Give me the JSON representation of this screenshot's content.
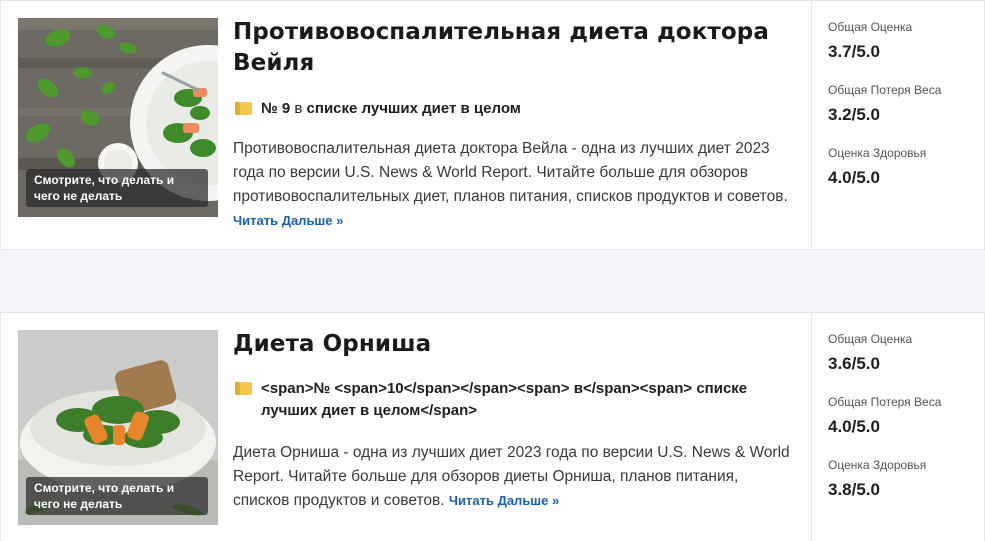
{
  "cards": [
    {
      "title": "Противовоспалительная диета доктора Вейля",
      "rank_bold": "№ 9",
      "rank_in": "в",
      "rank_list": "списке лучших диет в целом",
      "description": "Противовоспалительная диета доктора Вейла - одна из лучших диет 2023 года по версии U.S. News & World Report. Читайте больше для обзоров противовоспалительных диет, планов питания, списков продуктов и советов.",
      "read_more": "Читать Дальше »",
      "image_caption": "Смотрите, что делать и чего не делать",
      "scores": [
        {
          "label": "Общая Оценка",
          "value": "3.7/5.0"
        },
        {
          "label": "Общая Потеря Веса",
          "value": "3.2/5.0"
        },
        {
          "label": "Оценка Здоровья",
          "value": "4.0/5.0"
        }
      ]
    },
    {
      "title": "Диета Орниша",
      "rank_raw": "<span>№ <span>10</span></span><span> в</span><span> списке лучших диет в целом</span>",
      "description": "Диета Орниша - одна из лучших диет 2023 года по версии U.S. News & World Report. Читайте больше для обзоров диеты Орниша, планов питания, списков продуктов и советов.",
      "read_more": "Читать Дальше »",
      "image_caption": "Смотрите, что делать и чего не делать",
      "scores": [
        {
          "label": "Общая Оценка",
          "value": "3.6/5.0"
        },
        {
          "label": "Общая Потеря Веса",
          "value": "4.0/5.0"
        },
        {
          "label": "Оценка Здоровья",
          "value": "3.8/5.0"
        }
      ]
    }
  ],
  "colors": {
    "link": "#1a5fb4",
    "rank_icon": "#f2c94c",
    "background": "#f3f5f8"
  },
  "icons": {
    "rank": "ranking-badge-icon"
  }
}
